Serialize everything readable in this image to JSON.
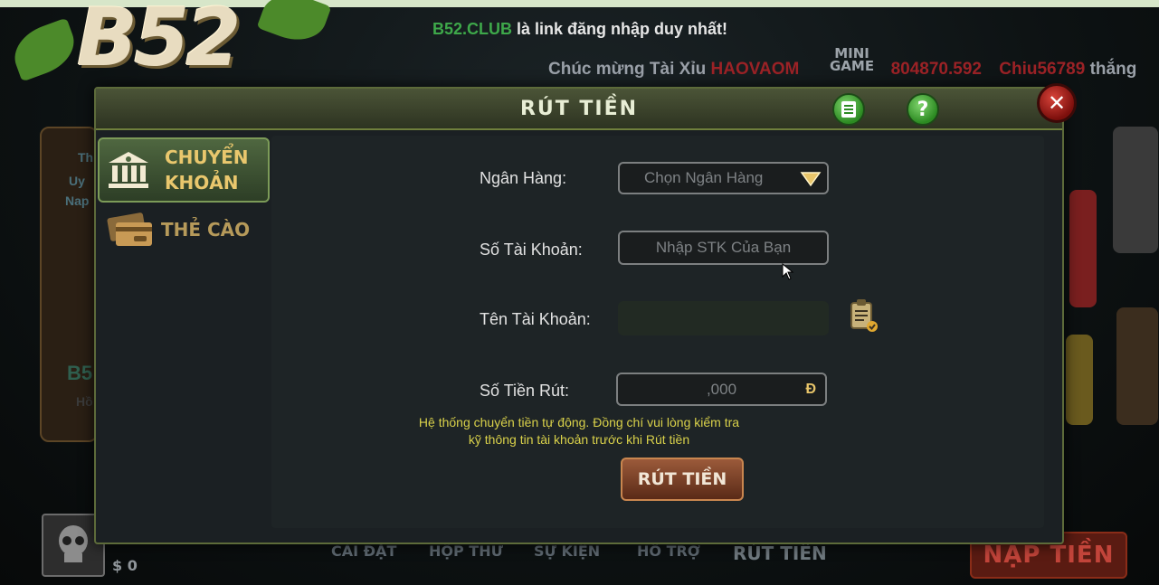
{
  "top_marquee": {
    "club": "B52.CLUB",
    "message": "là link đăng nhập duy nhất!"
  },
  "winner_ticker": {
    "prefix": "Chúc mừng Tài Xỉu",
    "user1": "HAOVAOM",
    "amount": "804870.592",
    "user2": "Chiu56789",
    "suffix": "thắng"
  },
  "logo": {
    "text": "B52"
  },
  "mini_game": {
    "line1": "MINI",
    "line2": "GAME"
  },
  "dialog": {
    "title": "RÚT TIỀN",
    "help_glyph": "?",
    "close_glyph": "✕",
    "tabs": [
      {
        "label_line1": "CHUYỂN",
        "label_line2": "KHOẢN",
        "active": true
      },
      {
        "label_line1": "THẺ CÀO",
        "label_line2": "",
        "active": false
      }
    ],
    "form": {
      "bank_label": "Ngân Hàng:",
      "bank_placeholder": "Chọn Ngân Hàng",
      "account_number_label": "Số Tài Khoản:",
      "account_number_placeholder": "Nhập STK Của Bạn",
      "account_name_label": "Tên Tài Khoản:",
      "account_name_value": "",
      "amount_label": "Số Tiền Rút:",
      "amount_placeholder": ",000",
      "currency_symbol": "Đ"
    },
    "notice_line1": "Hệ thống chuyển tiền tự động. Đồng chí vui lòng kiểm tra",
    "notice_line2": "kỹ thông tin tài khoản trước khi Rút tiền",
    "submit_label": "RÚT TIỀN"
  },
  "left_panel": {
    "line1": "Th",
    "line2": "Uy",
    "line3": "Nap",
    "b5": "B5",
    "ho": "Hồ"
  },
  "bottom_nav": {
    "items": [
      "CÀI ĐẶT",
      "HỘP THƯ",
      "SỰ KIỆN",
      "HỖ TRỢ",
      "RÚT TIỀN"
    ],
    "coins": "$ 0",
    "deposit_button": "NẠP TIỀN"
  },
  "colors": {
    "accent_green": "#3ea84a",
    "gold": "#e9c76d",
    "notice": "#d9d14a",
    "danger": "#c2443a"
  }
}
